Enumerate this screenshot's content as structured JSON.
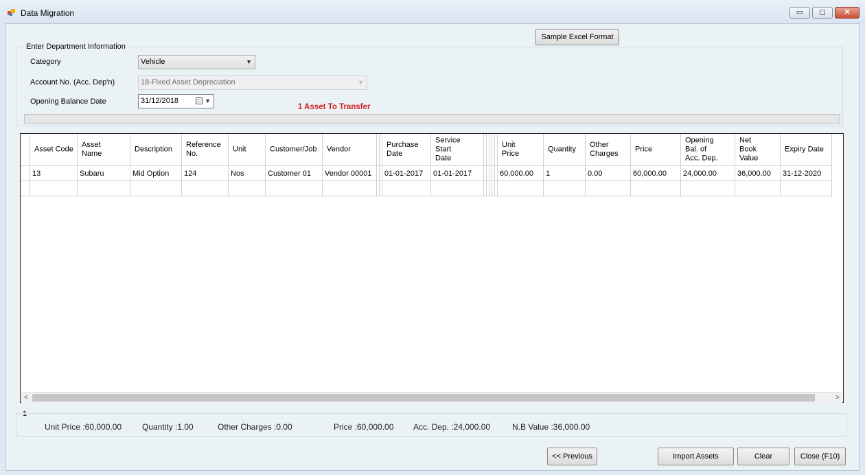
{
  "window": {
    "title": "Data Migration",
    "minimize": "▭",
    "restore": "◻",
    "close": "✕"
  },
  "buttons": {
    "sample_excel": "Sample Excel Format",
    "previous": "<< Previous",
    "import": "Import Assets",
    "clear": "Clear",
    "close": "Close (F10)"
  },
  "form": {
    "group_title": "Enter Department Information",
    "category_label": "Category",
    "category_value": "Vehicle",
    "account_label": "Account No. (Acc. Dep'n)",
    "account_value": "18-Fixed Asset Depreciation",
    "opening_label": "Opening Balance Date",
    "opening_value": "31/12/2018",
    "transfer_text": "1 Asset To Transfer"
  },
  "grid": {
    "headers": [
      "Asset Code",
      "Asset\nName",
      "Description",
      "Reference\nNo.",
      "Unit",
      "Customer/Job",
      "Vendor",
      "",
      "",
      "Purchase\nDate",
      "Service\nStart\nDate",
      "",
      "",
      "",
      "",
      "",
      "Unit\nPrice",
      "Quantity",
      "Other\nCharges",
      "Price",
      "Opening\nBal. of\nAcc. Dep.",
      "Net\nBook\nValue",
      "Expiry Date"
    ],
    "rows": [
      [
        "13",
        "Subaru",
        "Mid Option",
        "124",
        "Nos",
        "Customer 01",
        "Vendor 00001",
        "",
        "",
        "01-01-2017",
        "01-01-2017",
        "",
        "",
        "",
        "",
        "",
        "60,000.00",
        "1",
        "0.00",
        "60,000.00",
        "24,000.00",
        "36,000.00",
        "31-12-2020"
      ]
    ]
  },
  "status": {
    "row_count": "1",
    "unit_price": "Unit Price :60,000.00",
    "quantity": "Quantity :1.00",
    "other_charges": "Other Charges :0.00",
    "price": "Price :60,000.00",
    "acc_dep": "Acc. Dep. :24,000.00",
    "nb_value": "N.B Value :36,000.00"
  }
}
